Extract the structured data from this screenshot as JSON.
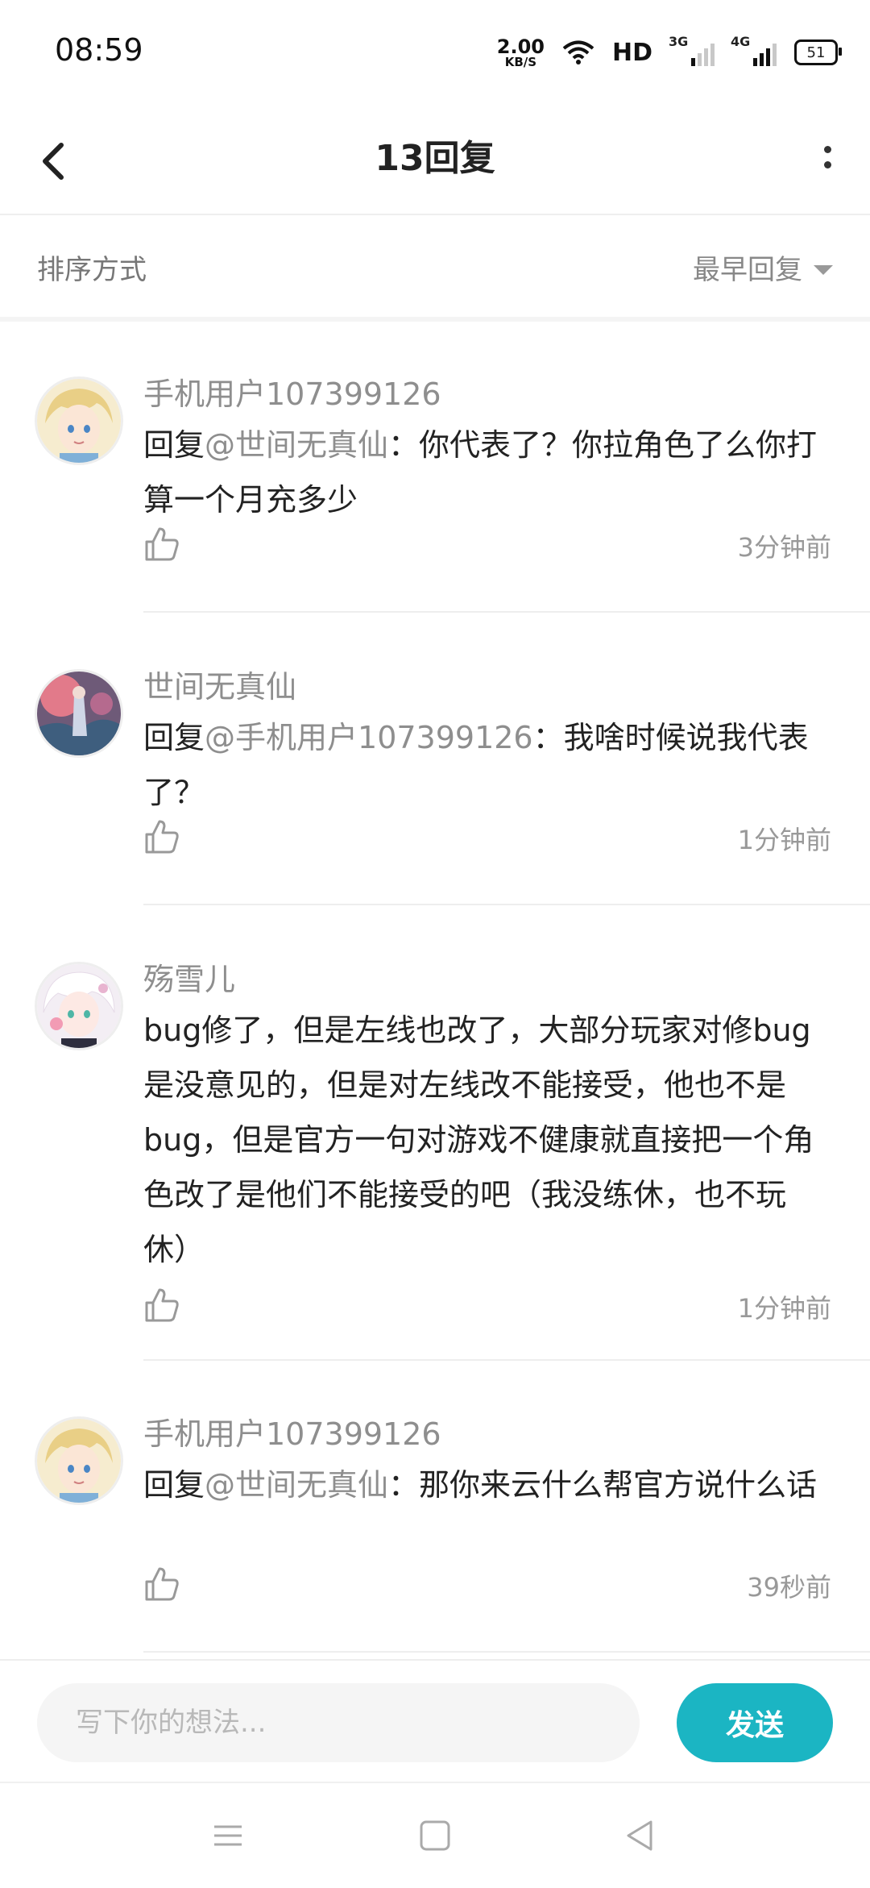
{
  "status_bar": {
    "time": "08:59",
    "net_speed_value": "2.00",
    "net_speed_unit": "KB/S",
    "hd_label": "HD",
    "sim1_label": "3G",
    "sim2_label": "4G",
    "battery": "51"
  },
  "header": {
    "title": "13回复"
  },
  "sort": {
    "label": "排序方式",
    "value": "最早回复"
  },
  "comments": [
    {
      "user": "手机用户107399126",
      "prefix": "回复",
      "mention": "@世间无真仙",
      "text": "：你代表了？你拉角色了么你打算一个月充多少",
      "time": "3分钟前"
    },
    {
      "user": "世间无真仙",
      "prefix": "回复",
      "mention": "@手机用户107399126",
      "text": "：我啥时候说我代表了？",
      "time": "1分钟前"
    },
    {
      "user": "殇雪儿",
      "prefix": "",
      "mention": "",
      "text": "bug修了，但是左线也改了，大部分玩家对修bug是没意见的，但是对左线改不能接受，他也不是bug，但是官方一句对游戏不健康就直接把一个角色改了是他们不能接受的吧（我没练休，也不玩休）",
      "time": "1分钟前"
    },
    {
      "user": "手机用户107399126",
      "prefix": "回复",
      "mention": "@世间无真仙",
      "text": "：那你来云什么帮官方说什么话",
      "time": "39秒前"
    }
  ],
  "input": {
    "placeholder": "写下你的想法...",
    "send_label": "发送"
  },
  "colors": {
    "accent": "#1bb5c3",
    "muted_text": "#8e8e8e"
  }
}
